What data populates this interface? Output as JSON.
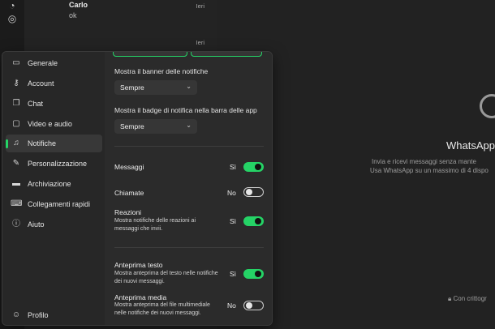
{
  "chat_list": [
    {
      "name": "Carlo",
      "message": "ok",
      "time": "Ieri"
    },
    {
      "name": "",
      "message": "",
      "time": "Ieri"
    }
  ],
  "empty_state": {
    "title": "WhatsApp p",
    "line1": "Invia e ricevi messaggi senza mante",
    "line2": "Usa WhatsApp su un massimo di 4 dispo",
    "encryption": "Con crittogr"
  },
  "settings_nav": [
    {
      "label": "Generale",
      "icon": "laptop-icon"
    },
    {
      "label": "Account",
      "icon": "key-icon"
    },
    {
      "label": "Chat",
      "icon": "chat-icon"
    },
    {
      "label": "Video e audio",
      "icon": "video-icon"
    },
    {
      "label": "Notifiche",
      "icon": "bell-icon",
      "active": true
    },
    {
      "label": "Personalizzazione",
      "icon": "brush-icon"
    },
    {
      "label": "Archiviazione",
      "icon": "storage-icon"
    },
    {
      "label": "Collegamenti rapidi",
      "icon": "keyboard-icon"
    },
    {
      "label": "Aiuto",
      "icon": "info-icon"
    }
  ],
  "profile_label": "Profilo",
  "notifications": {
    "banner_label": "Mostra il banner delle notifiche",
    "banner_value": "Sempre",
    "badge_label": "Mostra il badge di notifica nella barra delle app",
    "badge_value": "Sempre",
    "messages": {
      "title": "Messaggi",
      "state": "Sì",
      "on": true
    },
    "calls": {
      "title": "Chiamate",
      "state": "No",
      "on": false
    },
    "reactions": {
      "title": "Reazioni",
      "desc": "Mostra notifiche delle reazioni ai messaggi che invii.",
      "state": "Sì",
      "on": true
    },
    "text_preview": {
      "title": "Anteprima testo",
      "desc": "Mostra anteprima del testo nelle notifiche dei nuovi messaggi.",
      "state": "Sì",
      "on": true
    },
    "media_preview": {
      "title": "Anteprima media",
      "desc": "Mostra anteprima del file multimediale nelle notifiche dei nuovi messaggi.",
      "state": "No",
      "on": false
    }
  },
  "colors": {
    "accent": "#25d366",
    "panel": "#2b2b2b",
    "nav": "#272727",
    "background": "#202020"
  }
}
